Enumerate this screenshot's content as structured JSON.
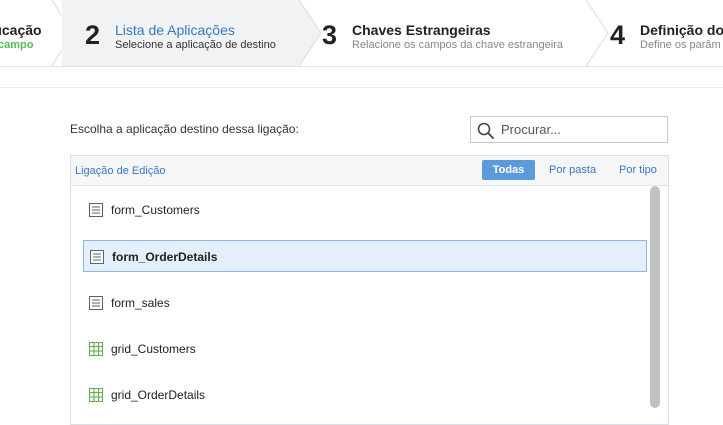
{
  "steps": [
    {
      "number": "",
      "title": "ıcação",
      "subtitle": "campo"
    },
    {
      "number": "2",
      "title": "Lista de Aplicações",
      "subtitle": "Selecione a aplicação de destino"
    },
    {
      "number": "3",
      "title": "Chaves Estrangeiras",
      "subtitle": "Relacione os campos da chave estrangeira"
    },
    {
      "number": "4",
      "title": "Definição dos",
      "subtitle": "Define os parâm"
    }
  ],
  "prompt": "Escolha a aplicação destino dessa ligação:",
  "search": {
    "placeholder": "Procurar..."
  },
  "panel": {
    "title": "Ligação de Edição",
    "filters": [
      "Todas",
      "Por pasta",
      "Por tipo"
    ],
    "active_filter": "Todas"
  },
  "items": [
    {
      "label": "form_Customers",
      "icon": "form-icon"
    },
    {
      "label": "form_OrderDetails",
      "icon": "form-icon",
      "selected": true
    },
    {
      "label": "form_sales",
      "icon": "form-icon"
    },
    {
      "label": "grid_Customers",
      "icon": "grid-icon"
    },
    {
      "label": "grid_OrderDetails",
      "icon": "grid-icon"
    }
  ],
  "colors": {
    "accent": "#3a78c2",
    "active_filter": "#5b9bd9",
    "done": "#55bb55",
    "selected_bg": "#e3f0fb"
  }
}
